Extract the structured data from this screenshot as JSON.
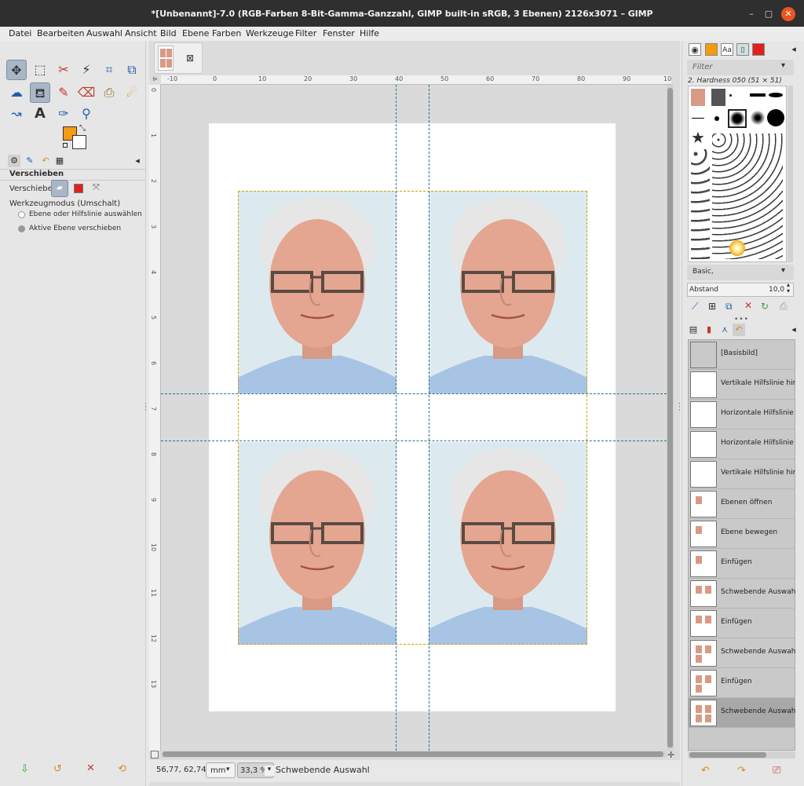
{
  "window": {
    "title": "*[Unbenannt]-7.0 (RGB-Farben 8-Bit-Gamma-Ganzzahl, GIMP built-in sRGB, 3 Ebenen) 2126x3071 – GIMP",
    "controls": [
      "–",
      "▢",
      "✕"
    ]
  },
  "menu": [
    "Datei",
    "Bearbeiten",
    "Auswahl",
    "Ansicht",
    "Bild",
    "Ebene",
    "Farben",
    "Werkzeuge",
    "Filter",
    "Fenster",
    "Hilfe"
  ],
  "toolbox": {
    "tools": [
      {
        "name": "move-tool",
        "glyph": "✥"
      },
      {
        "name": "rect-select-tool",
        "glyph": "⬚"
      },
      {
        "name": "free-select-tool",
        "glyph": "✂"
      },
      {
        "name": "fuzzy-select-tool",
        "glyph": "⚡"
      },
      {
        "name": "crop-tool",
        "glyph": "⌗"
      },
      {
        "name": "unified-transform-tool",
        "glyph": "⧉"
      },
      {
        "name": "warp-tool",
        "glyph": "☁"
      },
      {
        "name": "bucket-fill-tool",
        "glyph": "⛾"
      },
      {
        "name": "paintbrush-tool",
        "glyph": "✎"
      },
      {
        "name": "eraser-tool",
        "glyph": "⌫"
      },
      {
        "name": "clone-tool",
        "glyph": "⎙"
      },
      {
        "name": "smudge-tool",
        "glyph": "☄"
      },
      {
        "name": "paths-tool",
        "glyph": "↝"
      },
      {
        "name": "text-tool",
        "glyph": "A"
      },
      {
        "name": "color-picker-tool",
        "glyph": "✑"
      },
      {
        "name": "zoom-tool",
        "glyph": "⚲"
      }
    ],
    "fg_color": "#f39c12",
    "bg_color": "#ffffff",
    "options": {
      "title": "Verschieben",
      "move_label": "Verschieben:",
      "mode_label": "Werkzeugmodus (Umschalt)",
      "radio1": "Ebene oder Hilfslinie auswählen",
      "radio2": "Aktive Ebene verschieben"
    }
  },
  "canvas": {
    "ruler_top_labels": [
      "-10",
      "0",
      "10",
      "20",
      "30",
      "40",
      "50",
      "60",
      "70",
      "80",
      "90",
      "10"
    ],
    "ruler_left_labels": [
      "0",
      "1",
      "2",
      "3",
      "4",
      "5",
      "6",
      "7",
      "8",
      "9",
      "10",
      "11",
      "12",
      "13"
    ]
  },
  "status": {
    "coords": "56,77, 62,74",
    "unit": "mm",
    "zoom": "33,3 %",
    "message": "Schwebende Auswahl"
  },
  "brushes": {
    "filter_placeholder": "Filter",
    "selected_brush": "2. Hardness 050 (51 × 51)",
    "preset_tag": "Basic,",
    "spacing_label": "Abstand",
    "spacing_value": "10,0"
  },
  "history": {
    "items": [
      "[Basisbild]",
      "Vertikale Hilfslinie hinzufügen",
      "Horizontale Hilfslinie hinzufügen",
      "Horizontale Hilfslinie hinzufügen",
      "Vertikale Hilfslinie hinzufügen",
      "Ebenen öffnen",
      "Ebene bewegen",
      "Einfügen",
      "Schwebende Auswahl bewegen",
      "Einfügen",
      "Schwebende Auswahl bewegen",
      "Einfügen",
      "Schwebende Auswahl bewegen"
    ],
    "selected_index": 12
  }
}
